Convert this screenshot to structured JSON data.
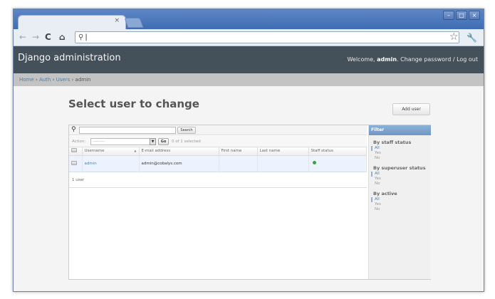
{
  "browser": {
    "tab_close": "×",
    "url": "",
    "window_controls": [
      "–",
      "□",
      "×"
    ]
  },
  "header": {
    "site_name": "Django administration",
    "welcome": "Welcome,",
    "username": "admin",
    "links": ". Change password / Log out"
  },
  "breadcrumbs": {
    "home": "Home",
    "auth": "Auth",
    "users": "Users",
    "current": "admin",
    "separator": "›"
  },
  "page": {
    "title": "Select user to change",
    "add_button": "Add user"
  },
  "search": {
    "value": "",
    "button": "Search"
  },
  "actions": {
    "label": "Action:",
    "selected_option": "---------",
    "go_button": "Go",
    "selection_count": "0 of 1 selected"
  },
  "table": {
    "columns": [
      "Username",
      "E-mail address",
      "First name",
      "Last name",
      "Staff status"
    ],
    "rows": [
      {
        "username": "admin",
        "email": "admin@cobalys.com",
        "first_name": "",
        "last_name": "",
        "staff_status": "true"
      }
    ],
    "sort_indicator": "▲"
  },
  "paginator": "1 user",
  "filter": {
    "title": "Filter",
    "groups": [
      {
        "title": "By staff status",
        "options": [
          "All",
          "Yes",
          "No"
        ],
        "selected": "All"
      },
      {
        "title": "By superuser status",
        "options": [
          "All",
          "Yes",
          "No"
        ],
        "selected": "All"
      },
      {
        "title": "By active",
        "options": [
          "All",
          "Yes",
          "No"
        ],
        "selected": "All"
      }
    ]
  },
  "colors": {
    "header_bg": "#44505a",
    "breadcrumb_bg": "#c3c3c3",
    "filter_header": "#7096c4",
    "link": "#4f7ea8",
    "status_ok": "#39a339"
  }
}
